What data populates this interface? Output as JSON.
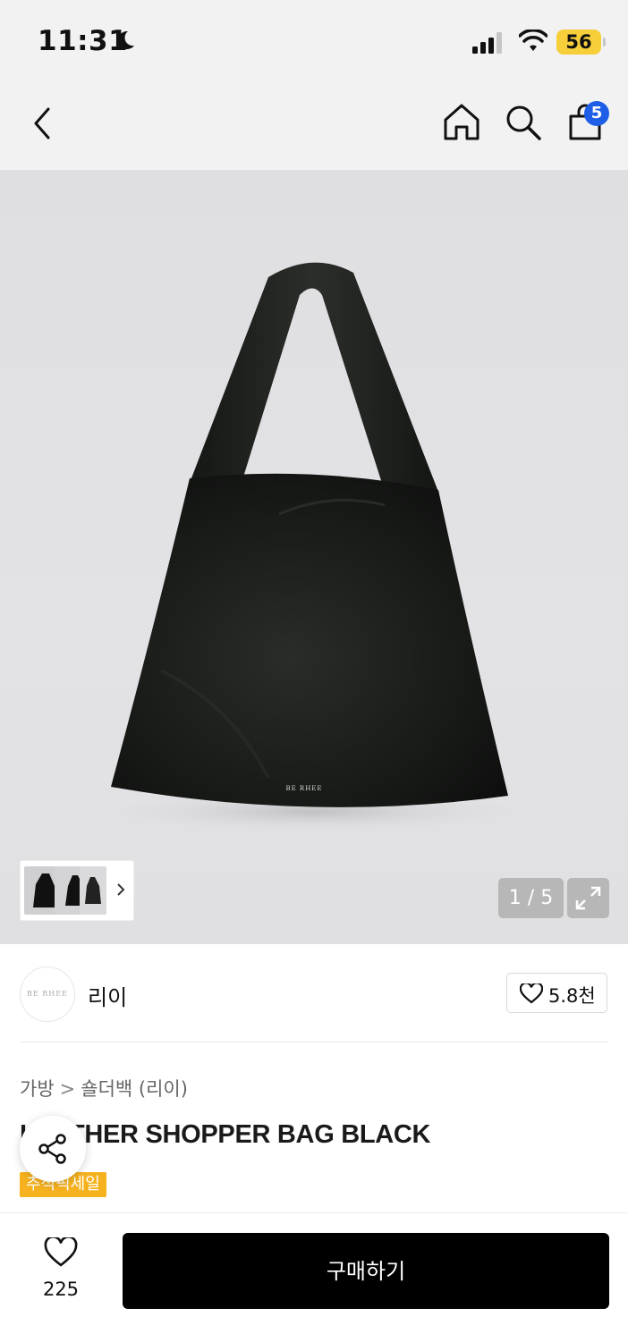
{
  "status_bar": {
    "time": "11:31",
    "battery": "56"
  },
  "nav": {
    "cart_count": "5"
  },
  "gallery": {
    "counter": "1 / 5",
    "image_logo_text": "BE RHEE",
    "thumbnail_count": 3
  },
  "brand": {
    "logo_text": "BE RHEE",
    "name": "리이",
    "likes": "5.8천"
  },
  "breadcrumb": {
    "category": "가방",
    "separator": ">",
    "subcategory": "숄더백 (리이)"
  },
  "product": {
    "title": "LEATHER SHOPPER BAG BLACK",
    "sale_badge": "추석픽세일"
  },
  "bottom_bar": {
    "wish_count": "225",
    "buy_label": "구매하기"
  },
  "colors": {
    "accent_blue": "#1f5fe8",
    "sale_orange": "#f6b21e",
    "buy_black": "#000000",
    "battery_yellow": "#f7cf3a"
  }
}
